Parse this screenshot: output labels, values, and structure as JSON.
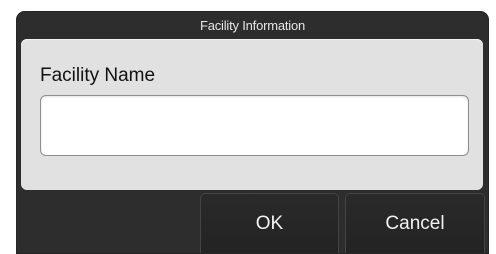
{
  "dialog": {
    "title": "Facility Information",
    "field": {
      "label": "Facility Name",
      "value": "",
      "placeholder": ""
    },
    "buttons": {
      "ok_label": "OK",
      "cancel_label": "Cancel"
    }
  },
  "colors": {
    "dialog_background": "#2d2d2d",
    "panel_background": "#e1e1e1",
    "input_background": "#ffffff",
    "title_text": "#e6e6e6",
    "button_text": "#f2f2f2"
  }
}
